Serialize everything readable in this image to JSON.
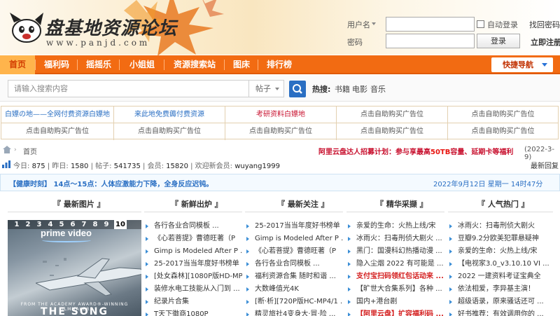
{
  "logo": {
    "cn": "盘基地资源论坛",
    "en": "www.panjd.com"
  },
  "login": {
    "username_label": "用户名",
    "password_label": "密码",
    "auto_login": "自动登录",
    "find_password": "找回密码",
    "login_button": "登录",
    "register": "立即注册"
  },
  "nav": {
    "items": [
      "首页",
      "福利码",
      "摇摇乐",
      "小姐姐",
      "资源搜索站",
      "图床",
      "排行榜"
    ],
    "quick": "快捷导航"
  },
  "search": {
    "placeholder": "请输入搜索内容",
    "scope": "帖子",
    "hot_title": "热搜:",
    "hot": [
      "书籍",
      "电影",
      "音乐"
    ]
  },
  "ads": [
    [
      "白嫖の地——全网付费资源白嫖地",
      "来此地免费薅付费资源",
      "考研资料白嫖地",
      "点击自助购买广告位",
      "点击自助购买广告位"
    ],
    [
      "点击自助购买广告位",
      "点击自助购买广告位",
      "点击自助购买广告位",
      "点击自助购买广告位",
      "点击自助购买广告位"
    ]
  ],
  "breadcrumb": {
    "arrow": "›",
    "home_label": "首页",
    "notice_prefix": "阿里云盘达人招募计划：参与享最高",
    "notice_strong": "50TB",
    "notice_suffix": "容量、延期卡等福利",
    "notice_date": "(2022-3-9)"
  },
  "stats": {
    "today_label": "今日: ",
    "today": "875",
    "yesterday_label": " | 昨日: ",
    "yesterday": "1580",
    "posts_label": " | 帖子: ",
    "posts": "541735",
    "members_label": " | 会员: ",
    "members": "15820",
    "welcome_label": " | 欢迎新会员: ",
    "newest": "wuyang1999",
    "latest_reply": "最新回复"
  },
  "health": {
    "message": "【健康时刻】 14点～15点：人体应激能力下降，全身反应迟钝。",
    "time": "2022年9月12日 星期一 14时47分"
  },
  "columns": {
    "headers": [
      "『 最新图片 』",
      "『 新鲜出炉 』",
      "『 最新关注 』",
      "『 精华采撷 』",
      "『 人气热门 』"
    ],
    "image_tabs": [
      "1",
      "2",
      "3",
      "4",
      "5",
      "6",
      "7",
      "8",
      "9",
      "10"
    ],
    "image_brand": "prime video",
    "image_caption": "FROM THE ACADEMY AWARD®-WINNING FILMMAKER",
    "image_title": "THE SONG",
    "new": [
      "各行各业合同模板 ...",
      "《心若菩提》曹德旺著（P",
      "Gimp is Modeled After P ...",
      "25-2017当当年度好书榜单",
      "[处女森林][1080P版HD-MP",
      "装修水电工技能从入门到 ...",
      "纪录片合集",
      "T天下徽商1080P"
    ],
    "follow": [
      "25-2017当当年度好书榜单",
      "Gimp is Modeled After P ...",
      "《心若菩提》曹德旺著（P",
      "各行各业合同模板 ...",
      "福利资源合集 随时和谐 ...",
      "大数峰值光4K",
      "[断·析][720P版HC-MP4/1 ...",
      "精灵旅社4变身大·冒·险 ..."
    ],
    "digest": [
      "亲爱的生命：火热上线/宋",
      "冰雨火：扫毒刑侦大剧火 ...",
      "黑门：国漫科幻热播动漫 ...",
      "隐入尘烟 2022 有可能是 ...",
      "支付宝扫码领红包话动来 ...",
      "【旷世大合集系列】各种 ...",
      "国内+港台剧",
      "【阿里云盘】扩容福利码 ..."
    ],
    "hot": [
      "冰雨火：扫毒刑侦大剧火",
      "豆瓣9.2分欧美犯罪悬疑神",
      "亲爱的生命：火热上线/宋",
      "【电视家3.0_v3.10.10 VI ...",
      "2022 一建资料考证宝典全",
      "依法相爱，李异基主演！",
      "超级语录，原来骚话还可 ...",
      "好书推荐：有效调用你的 ..."
    ]
  },
  "colors": {
    "nav": "#f26b12",
    "accent": "#2a6fc3",
    "notice": "#c8102e"
  }
}
